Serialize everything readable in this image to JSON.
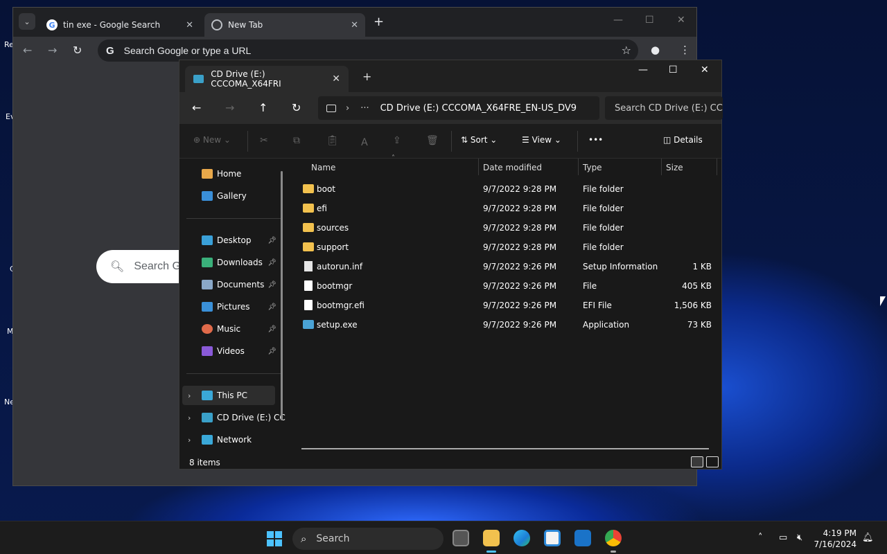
{
  "desktop": {
    "labels": [
      "Re",
      "Ev",
      "C",
      "M",
      "Ne"
    ]
  },
  "chrome": {
    "tabs": [
      {
        "title": "tin exe - Google Search",
        "favicon": "G"
      },
      {
        "title": "New Tab",
        "favicon": ""
      }
    ],
    "omnibox_placeholder": "Search Google or type a URL",
    "omnibox_g": "G",
    "page_search_placeholder": "Search Go"
  },
  "explorer": {
    "tab_title": "CD Drive (E:) CCCOMA_X64FRI",
    "address": "CD Drive (E:) CCCOMA_X64FRE_EN-US_DV9",
    "search_placeholder": "Search CD Drive (E:) CCCO",
    "commands": {
      "new": "New",
      "sort": "Sort",
      "view": "View",
      "details": "Details",
      "more": "•••"
    },
    "nav": [
      {
        "label": "Home",
        "color": "#e8a84a",
        "pinned": false
      },
      {
        "label": "Gallery",
        "color": "#3a8fd8",
        "pinned": false
      },
      {
        "label": "Desktop",
        "color": "#3aa0d8",
        "pinned": true
      },
      {
        "label": "Downloads",
        "color": "#3ab07a",
        "pinned": true
      },
      {
        "label": "Documents",
        "color": "#8aa8c8",
        "pinned": true
      },
      {
        "label": "Pictures",
        "color": "#3a90d8",
        "pinned": true
      },
      {
        "label": "Music",
        "color": "#e06a4a",
        "pinned": true
      },
      {
        "label": "Videos",
        "color": "#8a5ad8",
        "pinned": true
      },
      {
        "label": "This PC",
        "color": "#3aa8d8",
        "pinned": false
      },
      {
        "label": "CD Drive (E:) CC",
        "color": "#3aa0c8",
        "pinned": false
      },
      {
        "label": "Network",
        "color": "#3aa8d8",
        "pinned": false
      }
    ],
    "columns": {
      "name": "Name",
      "date": "Date modified",
      "type": "Type",
      "size": "Size"
    },
    "files": [
      {
        "name": "boot",
        "date": "9/7/2022 9:28 PM",
        "type": "File folder",
        "size": "",
        "kind": "folder"
      },
      {
        "name": "efi",
        "date": "9/7/2022 9:28 PM",
        "type": "File folder",
        "size": "",
        "kind": "folder"
      },
      {
        "name": "sources",
        "date": "9/7/2022 9:28 PM",
        "type": "File folder",
        "size": "",
        "kind": "folder"
      },
      {
        "name": "support",
        "date": "9/7/2022 9:28 PM",
        "type": "File folder",
        "size": "",
        "kind": "folder"
      },
      {
        "name": "autorun.inf",
        "date": "9/7/2022 9:26 PM",
        "type": "Setup Information",
        "size": "1 KB",
        "kind": "inf"
      },
      {
        "name": "bootmgr",
        "date": "9/7/2022 9:26 PM",
        "type": "File",
        "size": "405 KB",
        "kind": "file"
      },
      {
        "name": "bootmgr.efi",
        "date": "9/7/2022 9:26 PM",
        "type": "EFI File",
        "size": "1,506 KB",
        "kind": "file"
      },
      {
        "name": "setup.exe",
        "date": "9/7/2022 9:26 PM",
        "type": "Application",
        "size": "73 KB",
        "kind": "exe"
      }
    ],
    "status": "8 items"
  },
  "taskbar": {
    "search_label": "Search",
    "time": "4:19 PM",
    "date": "7/16/2024"
  }
}
